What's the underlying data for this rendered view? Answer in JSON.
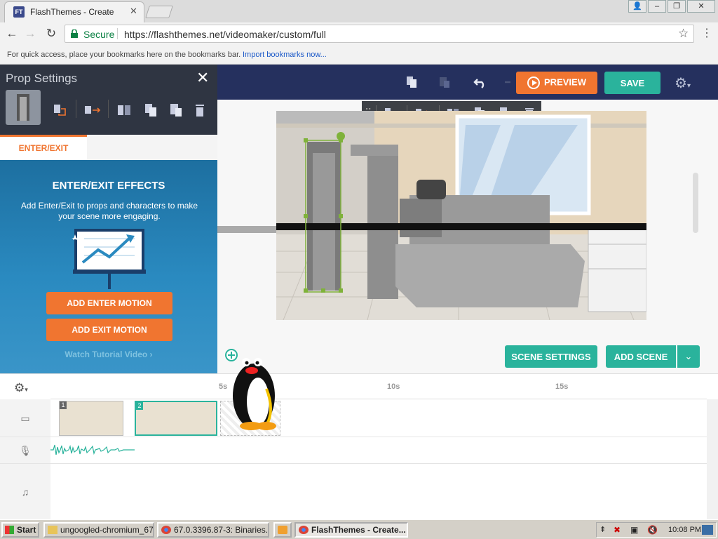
{
  "browser": {
    "tab_title": "FlashThemes - Create",
    "favicon_text": "FT",
    "secure_label": "Secure",
    "url": "https://flashthemes.net/videomaker/custom/full",
    "bookmarks_text": "For quick access, place your bookmarks here on the bookmarks bar.",
    "import_bookmarks": "Import bookmarks now..."
  },
  "header": {
    "preview_label": "PREVIEW",
    "save_label": "SAVE"
  },
  "prop_panel": {
    "title": "Prop Settings",
    "tab_label": "ENTER/EXIT",
    "effects_title": "ENTER/EXIT EFFECTS",
    "effects_desc": "Add Enter/Exit to props and characters to make your scene more engaging.",
    "add_enter_label": "ADD ENTER MOTION",
    "add_exit_label": "ADD EXIT MOTION",
    "tutorial_label": "Watch Tutorial Video"
  },
  "stage": {
    "scene_settings_label": "SCENE SETTINGS",
    "add_scene_label": "ADD SCENE"
  },
  "timeline": {
    "ticks": [
      "5s",
      "10s",
      "15s"
    ],
    "scenes": [
      {
        "number": "1"
      },
      {
        "number": "2"
      }
    ]
  },
  "taskbar": {
    "start_label": "Start",
    "items": [
      "ungoogled-chromium_67...",
      "67.0.3396.87-3: Binaries...",
      "FlashThemes - Create..."
    ],
    "clock": "10:08 PM"
  },
  "colors": {
    "header_navy": "#25305e",
    "accent_orange": "#f07530",
    "accent_teal": "#2ab39c",
    "panel_blue": "#2a8ac0"
  },
  "icons": {
    "header": [
      "copy-icon",
      "paste-icon",
      "undo-icon",
      "redo-icon",
      "settings-gear-icon"
    ],
    "prop_tools": [
      "swap-icon",
      "motion-icon",
      "flip-icon",
      "copy-icon",
      "paste-icon",
      "delete-icon"
    ]
  }
}
